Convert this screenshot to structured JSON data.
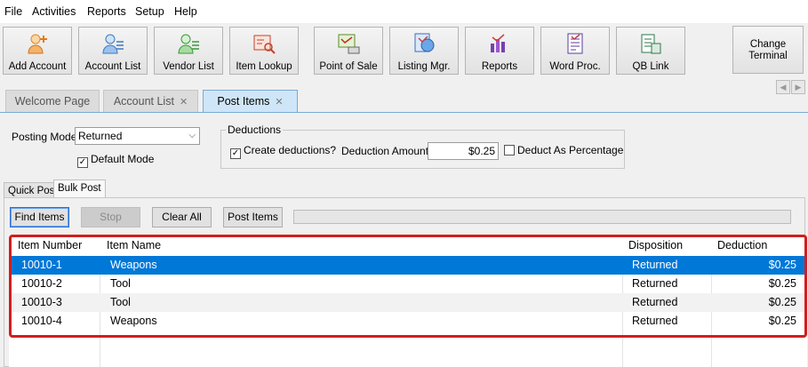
{
  "menu": [
    "File",
    "Activities",
    "Reports",
    "Setup",
    "Help"
  ],
  "toolbar": {
    "buttons": [
      {
        "label": "Add Account",
        "icon": "add-account-icon"
      },
      {
        "label": "Account List",
        "icon": "account-list-icon"
      },
      {
        "label": "Vendor List",
        "icon": "vendor-list-icon"
      },
      {
        "label": "Item Lookup",
        "icon": "item-lookup-icon"
      },
      {
        "label": "Point of Sale",
        "icon": "point-of-sale-icon"
      },
      {
        "label": "Listing Mgr.",
        "icon": "listing-manager-icon"
      },
      {
        "label": "Reports",
        "icon": "reports-icon"
      },
      {
        "label": "Word Proc.",
        "icon": "word-processor-icon"
      },
      {
        "label": "QB Link",
        "icon": "qb-link-icon"
      }
    ],
    "change_terminal": [
      "Change",
      "Terminal"
    ]
  },
  "tabs": [
    {
      "label": "Welcome Page",
      "closable": false
    },
    {
      "label": "Account List",
      "closable": true
    },
    {
      "label": "Post Items",
      "closable": true
    }
  ],
  "form": {
    "posting_mode_label": "Posting Mode",
    "posting_mode_value": "Returned",
    "default_mode_label": "Default Mode",
    "default_mode_checked": true,
    "deductions_title": "Deductions",
    "create_deductions_label": "Create deductions?",
    "create_deductions_checked": true,
    "deduction_amount_label": "Deduction Amount",
    "deduction_amount_value": "$0.25",
    "deduct_percentage_label": "Deduct As Percentage",
    "deduct_percentage_checked": false
  },
  "subtabs": [
    "Quick Post",
    "Bulk Post"
  ],
  "actions": {
    "find_items": "Find Items",
    "stop": "Stop",
    "clear_all": "Clear All",
    "post_items": "Post Items"
  },
  "grid": {
    "columns": [
      "Item Number",
      "Item Name",
      "Disposition",
      "Deduction"
    ],
    "rows": [
      {
        "number": "10010-1",
        "name": "Weapons",
        "disposition": "Returned",
        "deduction": "$0.25"
      },
      {
        "number": "10010-2",
        "name": "Tool",
        "disposition": "Returned",
        "deduction": "$0.25"
      },
      {
        "number": "10010-3",
        "name": "Tool",
        "disposition": "Returned",
        "deduction": "$0.25"
      },
      {
        "number": "10010-4",
        "name": "Weapons",
        "disposition": "Returned",
        "deduction": "$0.25"
      }
    ]
  },
  "colors": {
    "selection": "#0078d7",
    "highlight_border": "#d21e1e",
    "active_tab": "#cfe6f8"
  }
}
